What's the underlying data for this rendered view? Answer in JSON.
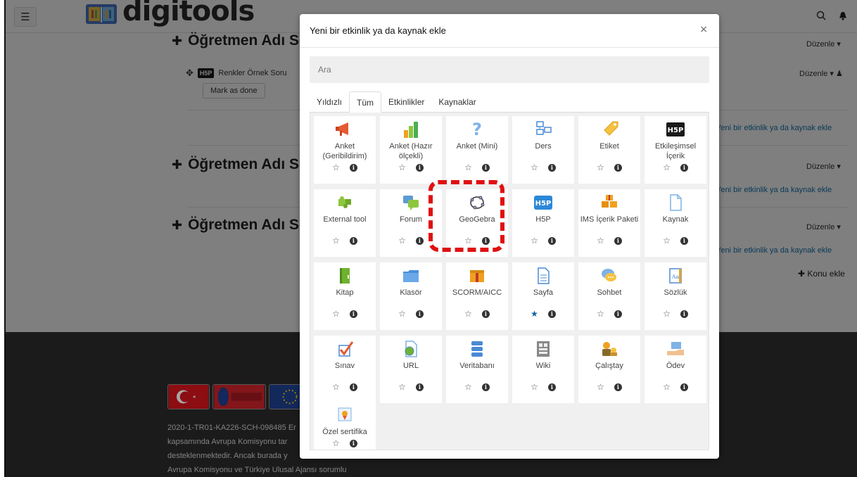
{
  "navbar": {
    "menu_icon": "hamburger-icon",
    "logo_text": "digitools",
    "search_icon": "search-icon",
    "bell_icon": "bell-icon"
  },
  "course": {
    "sections": [
      {
        "title": "Öğretmen Adı Soy",
        "edit": "Düzenle ▾"
      },
      {
        "title": "Öğretmen Adı Soy",
        "edit": "Düzenle ▾"
      },
      {
        "title": "Öğretmen Adı Soy",
        "edit": "Düzenle ▾"
      }
    ],
    "activity": {
      "badge": "H5P",
      "name": "Renkler Örnek Soru",
      "edit": "Düzenle ▾"
    },
    "mark_done": "Mark as done",
    "add_resource": "Yeni bir etkinlik ya da kaynak ekle",
    "add_topic": "Konu ekle"
  },
  "footer": {
    "lines": [
      "2020-1-TR01-KA226-SCH-098485 Er",
      "kapsamında Avrupa Komisyonu tar",
      "desteklenmektedir. Ancak burada y",
      "Avrupa Komisyonu ve Türkiye Ulusal Ajansı sorumlu"
    ]
  },
  "modal": {
    "title": "Yeni bir etkinlik ya da kaynak ekle",
    "close": "×",
    "search_placeholder": "Ara",
    "tabs": [
      "Yıldızlı",
      "Tüm",
      "Etkinlikler",
      "Kaynaklar"
    ],
    "active_tab": "Tüm",
    "items": [
      {
        "label": "Anket (Geribildirim)",
        "icon": "megaphone-icon",
        "starred": false
      },
      {
        "label": "Anket (Hazır ölçekli)",
        "icon": "bar-chart-icon",
        "starred": false
      },
      {
        "label": "Anket (Mini)",
        "icon": "question-mark-icon",
        "starred": false
      },
      {
        "label": "Ders",
        "icon": "flowchart-icon",
        "starred": false
      },
      {
        "label": "Etiket",
        "icon": "tag-icon",
        "starred": false
      },
      {
        "label": "Etkileşimsel İçerik",
        "icon": "h5p-black-icon",
        "starred": false
      },
      {
        "label": "External tool",
        "icon": "puzzle-icon",
        "starred": false
      },
      {
        "label": "Forum",
        "icon": "speech-bubbles-icon",
        "starred": false
      },
      {
        "label": "GeoGebra",
        "icon": "geogebra-icon",
        "starred": false
      },
      {
        "label": "H5P",
        "icon": "h5p-blue-icon",
        "starred": false
      },
      {
        "label": "IMS İçerik Paketi",
        "icon": "package-icon",
        "starred": false
      },
      {
        "label": "Kaynak",
        "icon": "file-icon",
        "starred": false
      },
      {
        "label": "Kitap",
        "icon": "book-icon",
        "starred": false
      },
      {
        "label": "Klasör",
        "icon": "folder-icon",
        "starred": false
      },
      {
        "label": "SCORM/AICC",
        "icon": "scorm-package-icon",
        "starred": false
      },
      {
        "label": "Sayfa",
        "icon": "page-icon",
        "starred": true
      },
      {
        "label": "Sohbet",
        "icon": "chat-icon",
        "starred": false
      },
      {
        "label": "Sözlük",
        "icon": "glossary-icon",
        "starred": false
      },
      {
        "label": "Sınav",
        "icon": "quiz-check-icon",
        "starred": false
      },
      {
        "label": "URL",
        "icon": "url-globe-icon",
        "starred": false
      },
      {
        "label": "Veritabanı",
        "icon": "database-icon",
        "starred": false
      },
      {
        "label": "Wiki",
        "icon": "wiki-icon",
        "starred": false
      },
      {
        "label": "Çalıştay",
        "icon": "workshop-icon",
        "starred": false
      },
      {
        "label": "Ödev",
        "icon": "assignment-icon",
        "starred": false
      },
      {
        "label": "Özel sertifika",
        "icon": "certificate-icon",
        "starred": false
      }
    ]
  },
  "colors": {
    "accent": "#1063a3",
    "highlight": "#e01010",
    "link": "#1173b0",
    "footer_bg": "#2a2a2a"
  }
}
